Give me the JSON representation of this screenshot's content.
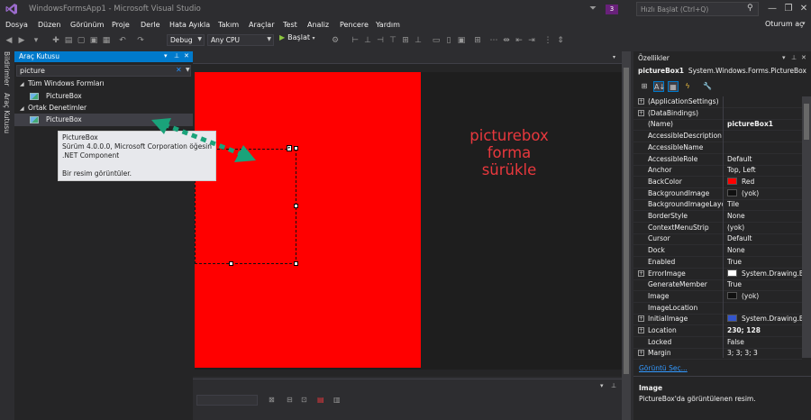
{
  "window": {
    "title": "WindowsFormsApp1 - Microsoft Visual Studio",
    "notification_count": "3",
    "quick_launch_placeholder": "Hızlı Başlat (Ctrl+Q)",
    "sign_in": "Oturum aç"
  },
  "menu": [
    "Dosya",
    "Düzen",
    "Görünüm",
    "Proje",
    "Derle",
    "Hata Ayıkla",
    "Takım",
    "Araçlar",
    "Test",
    "Analiz",
    "Pencere",
    "Yardım"
  ],
  "toolbar": {
    "config": "Debug",
    "platform": "Any CPU",
    "start_label": "Başlat"
  },
  "left_tabs": [
    "Bildirimler",
    "Araç Kutusu"
  ],
  "toolbox": {
    "title": "Araç Kutusu",
    "search_value": "picture",
    "groups": [
      {
        "name": "Tüm Windows Formları",
        "item": "PictureBox"
      },
      {
        "name": "Ortak Denetimler",
        "item": "PictureBox"
      }
    ]
  },
  "tooltip": {
    "lines": [
      "PictureBox",
      "Sürüm 4.0.0.0, Microsoft Corporation öğesinden",
      ".NET Component",
      "",
      "Bir resim görüntüler."
    ]
  },
  "designer": {
    "form_backcolor": "#ff0000",
    "annotation": [
      "picturebox",
      "forma",
      "sürükle"
    ],
    "annotation_color": "#e8383d",
    "arrow_color": "#1aa37a"
  },
  "properties": {
    "title": "Özellikler",
    "object_name": "pictureBox1",
    "object_type": "System.Windows.Forms.PictureBox",
    "rows": [
      {
        "name": "(ApplicationSettings)",
        "value": "",
        "expand": "+"
      },
      {
        "name": "(DataBindings)",
        "value": "",
        "expand": "+"
      },
      {
        "name": "(Name)",
        "value": "pictureBox1",
        "bold": true
      },
      {
        "name": "AccessibleDescription",
        "value": ""
      },
      {
        "name": "AccessibleName",
        "value": ""
      },
      {
        "name": "AccessibleRole",
        "value": "Default"
      },
      {
        "name": "Anchor",
        "value": "Top, Left"
      },
      {
        "name": "BackColor",
        "value": "Red",
        "swatch": "#ff0000"
      },
      {
        "name": "BackgroundImage",
        "value": "(yok)",
        "swatch": "#111111"
      },
      {
        "name": "BackgroundImageLayout",
        "value": "Tile"
      },
      {
        "name": "BorderStyle",
        "value": "None"
      },
      {
        "name": "ContextMenuStrip",
        "value": "(yok)"
      },
      {
        "name": "Cursor",
        "value": "Default"
      },
      {
        "name": "Dock",
        "value": "None"
      },
      {
        "name": "Enabled",
        "value": "True"
      },
      {
        "name": "ErrorImage",
        "value": "System.Drawing.Bitmap",
        "expand": "+",
        "swatch": "#ffffff"
      },
      {
        "name": "GenerateMember",
        "value": "True"
      },
      {
        "name": "Image",
        "value": "(yok)",
        "swatch": "#111111"
      },
      {
        "name": "ImageLocation",
        "value": ""
      },
      {
        "name": "InitialImage",
        "value": "System.Drawing.Bitmap",
        "expand": "+",
        "swatch": "#3355cc"
      },
      {
        "name": "Location",
        "value": "230; 128",
        "expand": "+",
        "bold": true
      },
      {
        "name": "Locked",
        "value": "False"
      },
      {
        "name": "Margin",
        "value": "3; 3; 3; 3",
        "expand": "+"
      }
    ],
    "link": "Görüntü Seç...",
    "desc_title": "Image",
    "desc_text": "PictureBox'da görüntülenen resim."
  }
}
